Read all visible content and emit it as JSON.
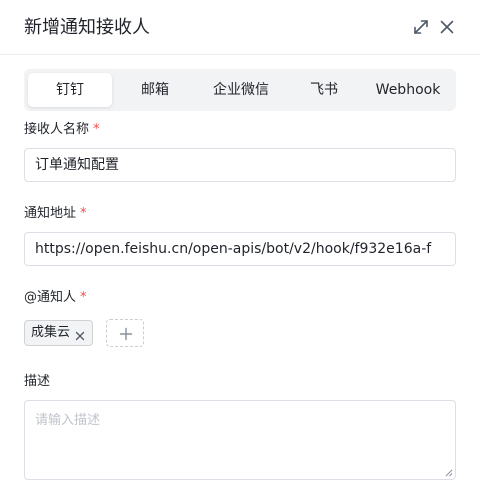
{
  "dialog": {
    "title": "新增通知接收人",
    "icons": {
      "expand": "expand-icon",
      "close": "close-icon"
    }
  },
  "tabs": [
    {
      "label": "钉钉",
      "active": true
    },
    {
      "label": "邮箱",
      "active": false
    },
    {
      "label": "企业微信",
      "active": false
    },
    {
      "label": "飞书",
      "active": false
    },
    {
      "label": "Webhook",
      "active": false
    }
  ],
  "form": {
    "name": {
      "label": "接收人名称",
      "required_mark": "*",
      "value": "订单通知配置"
    },
    "address": {
      "label": "通知地址",
      "required_mark": "*",
      "value": "https://open.feishu.cn/open-apis/bot/v2/hook/f932e16a-f"
    },
    "mention": {
      "label": "@通知人",
      "required_mark": "*",
      "chips": [
        "成集云"
      ],
      "add_icon": "plus-icon"
    },
    "description": {
      "label": "描述",
      "placeholder": "请输入描述",
      "value": ""
    }
  },
  "colors": {
    "required": "#f54a45",
    "tab_bg": "#f2f3f5",
    "border": "#dcdfe6",
    "placeholder": "#c0c4cc"
  }
}
